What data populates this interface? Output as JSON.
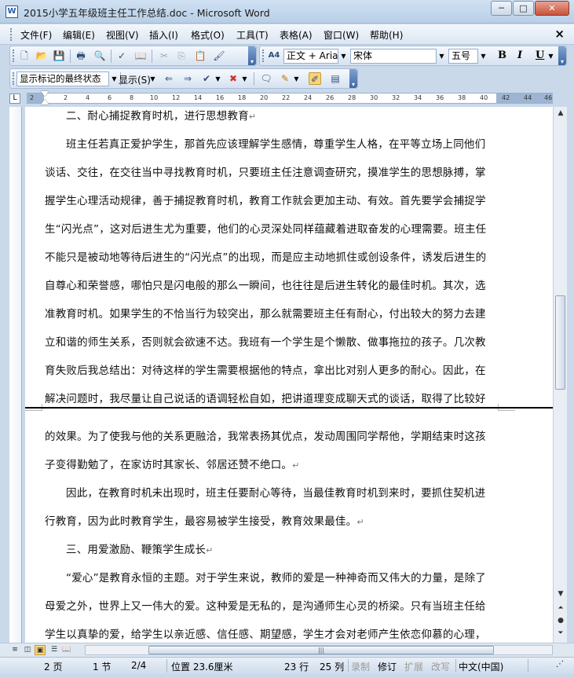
{
  "window": {
    "title": "2015小学五年级班主任工作总结.doc - Microsoft Word",
    "app_icon": "W",
    "minimize": "─",
    "maximize": "□",
    "close": "✕"
  },
  "menu": {
    "items": [
      "文件(F)",
      "编辑(E)",
      "视图(V)",
      "插入(I)",
      "格式(O)",
      "工具(T)",
      "表格(A)",
      "窗口(W)",
      "帮助(H)"
    ],
    "doc_close": "×"
  },
  "format_toolbar": {
    "style_value": "正文 + Aria",
    "font_value": "宋体",
    "size_value": "五号",
    "bold": "B",
    "italic": "I",
    "underline": "U",
    "style_icon": "A4"
  },
  "review_toolbar": {
    "display_mode": "显示标记的最终状态",
    "show_label": "显示(S)"
  },
  "ruler": {
    "corner": "L",
    "ticks": [
      "2",
      "2",
      "4",
      "6",
      "8",
      "10",
      "12",
      "14",
      "16",
      "18",
      "20",
      "22",
      "24",
      "26",
      "28",
      "30",
      "32",
      "34",
      "36",
      "38",
      "40",
      "42",
      "44",
      "46"
    ]
  },
  "document": {
    "lines": [
      "二、耐心捕捉教育时机，进行思想教育",
      "班主任若真正爱护学生，那首先应该理解学生感情，尊重学生人格，在平等立场上同他们",
      "谈话、交往，在交往当中寻找教育时机，只要班主任注意调查研究，摸准学生的思想脉搏，掌",
      "握学生心理活动规律，善于捕捉教育时机，教育工作就会更加主动、有效。首先要学会捕捉学",
      "生“闪光点”，这对后进生尤为重要，他们的心灵深处同样蕴藏着进取奋发的心理需要。班主任",
      "不能只是被动地等待后进生的“闪光点”的出现，而是应主动地抓住或创设条件，诱发后进生的",
      "自尊心和荣誉感，哪怕只是闪电般的那么一瞬间，也往往是后进生转化的最佳时机。其次，选",
      "准教育时机。如果学生的不恰当行为较突出，那么就需要班主任有耐心，付出较大的努力去建",
      "立和谐的师生关系，否则就会欲速不达。我班有一个学生是个懒散、做事拖拉的孩子。几次教",
      "育失败后我总结出：对待这样的学生需要根据他的特点，拿出比对别人更多的耐心。因此，在",
      "解决问题时，我尽量让自己说话的语调轻松自如，把讲道理变成聊天式的谈话，取得了比较好",
      "的效果。为了使我与他的关系更融洽，我常表扬其优点，发动周围同学帮他，学期结束时这孩",
      "子变得勤勉了，在家访时其家长、邻居还赞不绝口。",
      "因此，在教育时机未出现时，班主任要耐心等待，当最佳教育时机到来时，要抓住契机进",
      "行教育，因为此时教育学生，最容易被学生接受，教育效果最佳。",
      "三、用爱激励、鞭策学生成长",
      "“爱心”是教育永恒的主题。对于学生来说，教师的爱是一种神奇而又伟大的力量，是除了",
      "母爱之外，世界上又一伟大的爱。这种爱是无私的，是沟通师生心灵的桥梁。只有当班主任给",
      "学生以真挚的爱，给学生以亲近感、信任感、期望感，学生才会对老师产生依恋仰慕的心理，"
    ],
    "paragraph_mark": "↵"
  },
  "status": {
    "page": "2 页",
    "section": "1 节",
    "page_of": "2/4",
    "position": "位置 23.6厘米",
    "line": "23 行",
    "column": "25 列",
    "rec": "录制",
    "trk": "修订",
    "ext": "扩展",
    "ovr": "改写",
    "language": "中文(中国)"
  },
  "icons": {
    "new": "new-doc-icon",
    "open": "open-folder-icon",
    "save": "save-icon",
    "print": "print-icon",
    "preview": "print-preview-icon",
    "spell": "spell-check-icon",
    "cut": "cut-icon",
    "copy": "copy-icon",
    "paste": "paste-icon",
    "format_painter": "format-painter-icon"
  }
}
